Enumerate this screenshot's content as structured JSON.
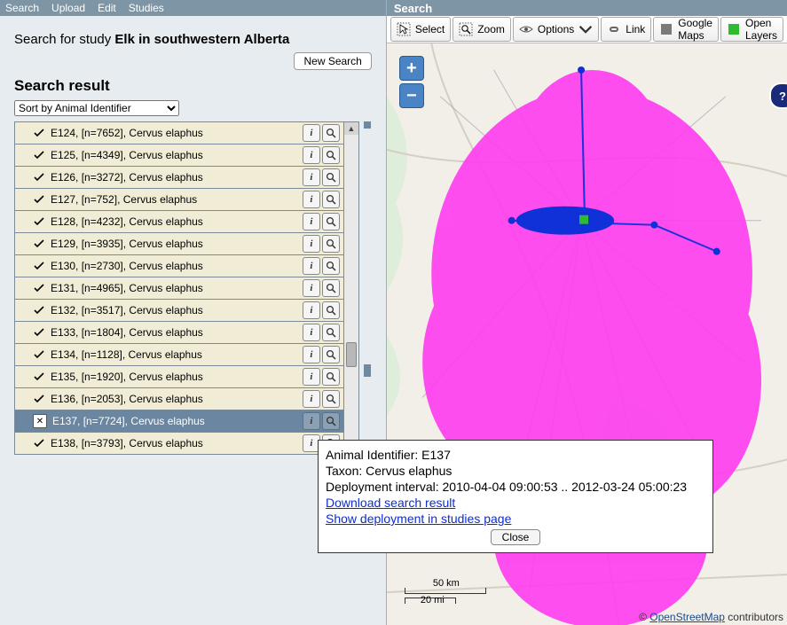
{
  "menu": {
    "search": "Search",
    "upload": "Upload",
    "edit": "Edit",
    "studies": "Studies"
  },
  "search_header": {
    "prefix": "Search for study ",
    "study": "Elk in southwestern Alberta"
  },
  "new_search": "New Search",
  "result_title": "Search result",
  "sort_label": "Sort by Animal Identifier",
  "rows": [
    {
      "id": "E124",
      "n": 7652,
      "taxon": "Cervus elaphus",
      "selected": false
    },
    {
      "id": "E125",
      "n": 4349,
      "taxon": "Cervus elaphus",
      "selected": false
    },
    {
      "id": "E126",
      "n": 3272,
      "taxon": "Cervus elaphus",
      "selected": false
    },
    {
      "id": "E127",
      "n": 752,
      "taxon": "Cervus elaphus",
      "selected": false
    },
    {
      "id": "E128",
      "n": 4232,
      "taxon": "Cervus elaphus",
      "selected": false
    },
    {
      "id": "E129",
      "n": 3935,
      "taxon": "Cervus elaphus",
      "selected": false
    },
    {
      "id": "E130",
      "n": 2730,
      "taxon": "Cervus elaphus",
      "selected": false
    },
    {
      "id": "E131",
      "n": 4965,
      "taxon": "Cervus elaphus",
      "selected": false
    },
    {
      "id": "E132",
      "n": 3517,
      "taxon": "Cervus elaphus",
      "selected": false
    },
    {
      "id": "E133",
      "n": 1804,
      "taxon": "Cervus elaphus",
      "selected": false
    },
    {
      "id": "E134",
      "n": 1128,
      "taxon": "Cervus elaphus",
      "selected": false
    },
    {
      "id": "E135",
      "n": 1920,
      "taxon": "Cervus elaphus",
      "selected": false
    },
    {
      "id": "E136",
      "n": 2053,
      "taxon": "Cervus elaphus",
      "selected": false
    },
    {
      "id": "E137",
      "n": 7724,
      "taxon": "Cervus elaphus",
      "selected": true
    },
    {
      "id": "E138",
      "n": 3793,
      "taxon": "Cervus elaphus",
      "selected": false
    }
  ],
  "right_panel_title": "Search",
  "toolbar": {
    "select": "Select",
    "zoom": "Zoom",
    "options": "Options",
    "link": "Link",
    "google": "Google Maps",
    "open": "Open Layers"
  },
  "popup": {
    "id_label": "Animal Identifier: ",
    "id_value": "E137",
    "taxon_label": "Taxon: ",
    "taxon_value": "Cervus elaphus",
    "interval_label": "Deployment interval: ",
    "interval_value": "2010-04-04 09:00:53 .. 2012-03-24 05:00:23",
    "download": "Download search result",
    "showdep": "Show deployment in studies page",
    "close": "Close"
  },
  "scale": {
    "km": "50 km",
    "mi": "20 mi"
  },
  "attribution": {
    "prefix": "© ",
    "link": "OpenStreetMap",
    "suffix": " contributors"
  },
  "zoom": {
    "in": "+",
    "out": "−"
  },
  "help": "?",
  "info_icon": "i"
}
